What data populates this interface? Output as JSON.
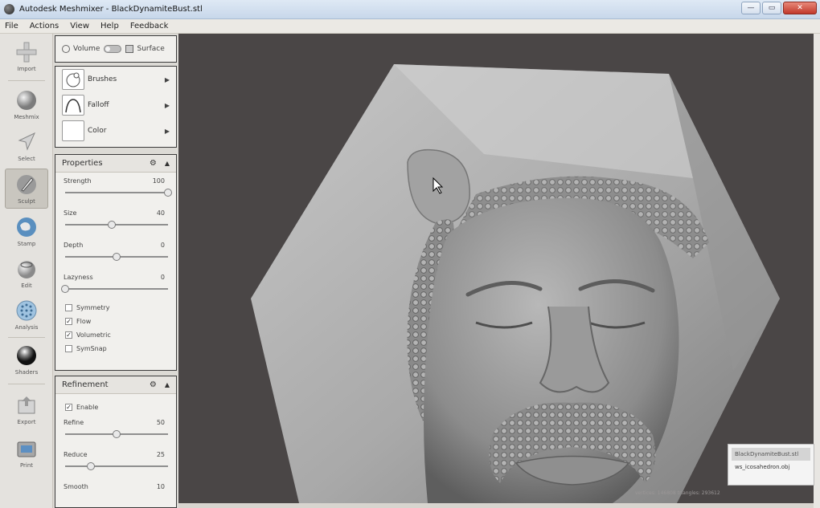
{
  "window": {
    "title": "Autodesk Meshmixer - BlackDynamiteBust.stl",
    "minimize_label": "—",
    "maximize_label": "▭",
    "close_label": "✕"
  },
  "menu": [
    "File",
    "Actions",
    "View",
    "Help",
    "Feedback"
  ],
  "tools": [
    {
      "label": "Import",
      "icon": "plus-icon"
    },
    {
      "label": "Meshmix",
      "icon": "sphere-icon"
    },
    {
      "label": "Select",
      "icon": "cursor-icon"
    },
    {
      "label": "Sculpt",
      "icon": "brush-icon",
      "active": true
    },
    {
      "label": "Stamp",
      "icon": "globe-stamp-icon"
    },
    {
      "label": "Edit",
      "icon": "edit-sphere-icon"
    },
    {
      "label": "Analysis",
      "icon": "analysis-sphere-icon"
    },
    {
      "label": "Shaders",
      "icon": "shader-ball-icon"
    },
    {
      "label": "Export",
      "icon": "export-icon"
    },
    {
      "label": "Print",
      "icon": "printer-icon"
    }
  ],
  "mode": {
    "volume_label": "Volume",
    "surface_label": "Surface"
  },
  "brush_panel": {
    "brushes_label": "Brushes",
    "falloff_label": "Falloff",
    "color_label": "Color"
  },
  "properties": {
    "title": "Properties",
    "strength": {
      "label": "Strength",
      "value": "100",
      "fraction": 1.0
    },
    "size": {
      "label": "Size",
      "value": "40",
      "fraction": 0.45
    },
    "depth": {
      "label": "Depth",
      "value": "0",
      "fraction": 0.5
    },
    "lazyness": {
      "label": "Lazyness",
      "value": "0",
      "fraction": 0.0
    },
    "symmetry": {
      "label": "Symmetry",
      "checked": false
    },
    "flow": {
      "label": "Flow",
      "checked": true
    },
    "volumetric": {
      "label": "Volumetric",
      "checked": true
    },
    "symsnap": {
      "label": "SymSnap",
      "checked": false
    }
  },
  "refinement": {
    "title": "Refinement",
    "enable": {
      "label": "Enable",
      "checked": true
    },
    "refine": {
      "label": "Refine",
      "value": "50",
      "fraction": 0.5
    },
    "reduce": {
      "label": "Reduce",
      "value": "25",
      "fraction": 0.25
    },
    "smooth": {
      "label": "Smooth",
      "value": "10"
    }
  },
  "scene_objects": [
    "BlackDynamiteBust.stl",
    "ws_icosahedron.obj"
  ],
  "status": "vertices: 146808 triangles: 293612"
}
